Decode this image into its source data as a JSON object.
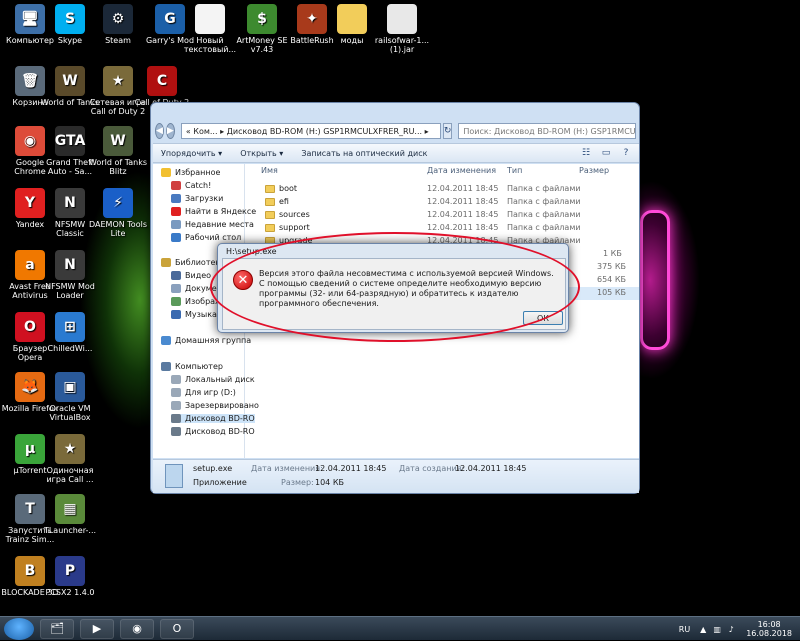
{
  "desktop": {
    "icons": [
      {
        "label": "Компьютер",
        "glyph": "🖥",
        "color": "#3d6fa8"
      },
      {
        "label": "Skype",
        "glyph": "S",
        "color": "#00aff0"
      },
      {
        "label": "Steam",
        "glyph": "⚙",
        "color": "#1b2838"
      },
      {
        "label": "Garry's Mod",
        "glyph": "G",
        "color": "#1b5fa8"
      },
      {
        "label": "Новый текстовый...",
        "glyph": "",
        "color": "#f4f4f4"
      },
      {
        "label": "ArtMoney SE v7.43",
        "glyph": "$",
        "color": "#3d8a2f"
      },
      {
        "label": "BattleRush",
        "glyph": "✦",
        "color": "#a83a1b"
      },
      {
        "label": "моды",
        "glyph": "",
        "color": "#f2cd5a"
      },
      {
        "label": "railsofwar-1... (1).jar",
        "glyph": "",
        "color": "#e8e8e8"
      },
      {
        "label": "Корзина",
        "glyph": "🗑",
        "color": "#5a6a7a"
      },
      {
        "label": "World of Tanks",
        "glyph": "W",
        "color": "#5a4a2a"
      },
      {
        "label": "Сетевая игра Call of Duty 2",
        "glyph": "★",
        "color": "#7a6a3a"
      },
      {
        "label": "Call of Duty 2",
        "glyph": "C",
        "color": "#b01010"
      },
      {
        "label": "Google Chrome",
        "glyph": "◉",
        "color": "#dd4b39"
      },
      {
        "label": "Grand Theft Auto - Sa...",
        "glyph": "GTA",
        "color": "#2a2a2a"
      },
      {
        "label": "World of Tanks Blitz",
        "glyph": "W",
        "color": "#4a5a3a"
      },
      {
        "label": "Yandex",
        "glyph": "Y",
        "color": "#e02020"
      },
      {
        "label": "NFSMW Classic",
        "glyph": "N",
        "color": "#3a3a3a"
      },
      {
        "label": "DAEMON Tools Lite",
        "glyph": "⚡",
        "color": "#1a5fc8"
      },
      {
        "label": "Avast Free Antivirus",
        "glyph": "a",
        "color": "#f07800"
      },
      {
        "label": "NFSMW Mod Loader",
        "glyph": "N",
        "color": "#3a3a3a"
      },
      {
        "label": "Браузер Opera",
        "glyph": "O",
        "color": "#d01020"
      },
      {
        "label": "ChilledWi...",
        "glyph": "⊞",
        "color": "#2a7ad0"
      },
      {
        "label": "Mozilla Firefox",
        "glyph": "🦊",
        "color": "#e56a12"
      },
      {
        "label": "Oracle VM VirtualBox",
        "glyph": "▣",
        "color": "#2a5a9a"
      },
      {
        "label": "µTorrent",
        "glyph": "µ",
        "color": "#3aa53a"
      },
      {
        "label": "Одиночная игра Call ...",
        "glyph": "★",
        "color": "#7a6a3a"
      },
      {
        "label": "Запустить Trainz Sim...",
        "glyph": "T",
        "color": "#5a6a7a"
      },
      {
        "label": "TLauncher-...",
        "glyph": "▦",
        "color": "#5a8a3a"
      },
      {
        "label": "BLOCKADE 3D",
        "glyph": "B",
        "color": "#c08020"
      },
      {
        "label": "PCSX2 1.4.0",
        "glyph": "P",
        "color": "#2a3a8a"
      }
    ]
  },
  "explorer": {
    "address": "« Ком... ▸ Дисковод BD-ROM (H:) GSP1RMCULXFRER_RU... ▸",
    "search_placeholder": "Поиск: Дисковод BD-ROM (H:) GSP1RMCUL...",
    "toolbar": {
      "organize": "Упорядочить ▾",
      "open": "Открыть ▾",
      "burn": "Записать на оптический диск"
    },
    "nav": {
      "favorites": "Избранное",
      "fav_items": [
        "Catch!",
        "Загрузки",
        "Найти в Яндексе",
        "Недавние места",
        "Рабочий стол"
      ],
      "libraries": "Библиотеки",
      "lib_items": [
        "Видео",
        "Документы",
        "Изображения",
        "Музыка"
      ],
      "homegroup": "Домашняя группа",
      "computer": "Компьютер",
      "comp_items": [
        "Локальный диск",
        "Для игр (D:)",
        "Зарезервировано",
        "Дисковод BD-RO",
        "Дисковод BD-RO"
      ]
    },
    "columns": {
      "name": "Имя",
      "date": "Дата изменения",
      "type": "Тип",
      "size": "Размер"
    },
    "rows": [
      {
        "name": "boot",
        "date": "12.04.2011 18:45",
        "type": "Папка с файлами",
        "size": ""
      },
      {
        "name": "efi",
        "date": "12.04.2011 18:45",
        "type": "Папка с файлами",
        "size": ""
      },
      {
        "name": "sources",
        "date": "12.04.2011 18:45",
        "type": "Папка с файлами",
        "size": ""
      },
      {
        "name": "support",
        "date": "12.04.2011 18:45",
        "type": "Папка с файлами",
        "size": ""
      },
      {
        "name": "upgrade",
        "date": "12.04.2011 18:45",
        "type": "Папка с файлами",
        "size": ""
      }
    ],
    "partial_sizes": [
      "1 КБ",
      "375 КБ",
      "654 КБ",
      "105 КБ"
    ],
    "details": {
      "filename": "setup.exe",
      "kind": "Приложение",
      "modified_label": "Дата изменения:",
      "modified_value": "12.04.2011 18:45",
      "created_label": "Дата создания:",
      "created_value": "12.04.2011 18:45",
      "size_label": "Размер:",
      "size_value": "104 КБ"
    }
  },
  "dialog": {
    "title": "H:\\setup.exe",
    "message": "Версия этого файла несовместима с используемой версией Windows. С помощью сведений о системе определите необходимую версию программы (32- или 64-разрядную) и обратитесь к издателю программного обеспечения.",
    "ok_label": "ОК"
  },
  "taskbar": {
    "apps": [
      "🗂",
      "▶",
      "◉",
      "O"
    ],
    "lang": "RU",
    "time": "16:08",
    "date": "16.08.2018"
  }
}
